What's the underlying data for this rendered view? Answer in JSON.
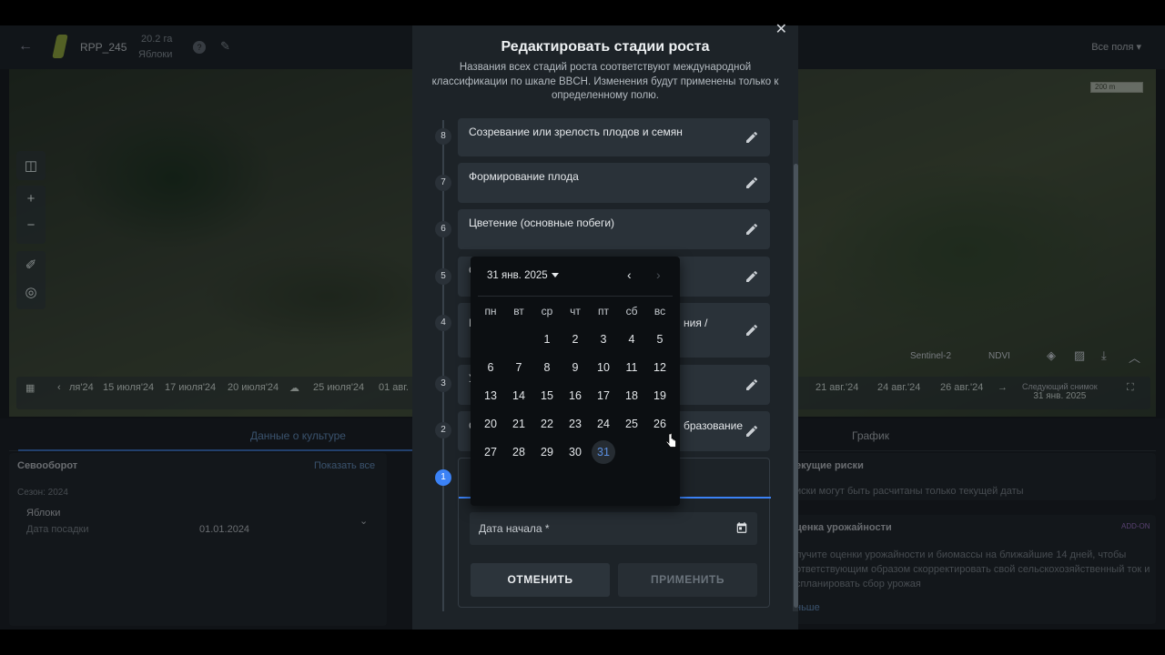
{
  "background": {
    "field_name": "RPP_245",
    "field_area": "20.2 га",
    "field_crop": "Яблоки",
    "help": "?",
    "all_fields": "Все поля",
    "scale": "200 m",
    "sat_source": "Sentinel-2",
    "index": "NDVI",
    "timeline": [
      "ля'24",
      "15 июля'24",
      "17 июля'24",
      "20 июля'24",
      "25 июля'24",
      "01 авг.",
      "21 авг.'24",
      "24 авг.'24",
      "26 авг.'24"
    ],
    "next_label": "Следующий снимок",
    "next_date": "31 янв. 2025",
    "tab_data": "Данные о культуре",
    "tab_chart": "График",
    "rotation_title": "Севооборот",
    "show_all": "Показать все",
    "season": "Сезон: 2024",
    "crop": "Яблоки",
    "planting_label": "Дата посадки",
    "planting_date": "01.01.2024",
    "risks_title": "екущие риски",
    "risks_text": "иски могут быть расчитаны только текущей даты",
    "yield_title": "ценка урожайности",
    "addon": "ADD-ON",
    "yield_text": "лучите оценки урожайности и биомассы на ближайшие 14 дней, чтобы ответствующим образом скорректировать свой сельскохозяйственный ток и спланировать сбор урожая",
    "more": "ньше"
  },
  "modal": {
    "title": "Редактировать стадии роста",
    "description": "Названия всех стадий роста соответствуют международной классификации по шкале BBCH. Изменения будут применены только к определенному полю.",
    "stages": [
      {
        "num": "8",
        "label": "Созревание или зрелость плодов и семян"
      },
      {
        "num": "7",
        "label": "Формирование плода"
      },
      {
        "num": "6",
        "label": "Цветение (основные побеги)"
      },
      {
        "num": "5",
        "label": "С"
      },
      {
        "num": "4",
        "label": "Р",
        "label_right": "ния /"
      },
      {
        "num": "3",
        "label": "У"
      },
      {
        "num": "2",
        "label": "С",
        "label_right": "бразование"
      },
      {
        "num": "1",
        "label": ""
      }
    ],
    "date_field_label": "Дата начала *",
    "cancel": "ОТМЕНИТЬ",
    "apply": "ПРИМЕНИТЬ"
  },
  "calendar": {
    "month_label": "31 янв. 2025",
    "weekdays": [
      "пн",
      "вт",
      "ср",
      "чт",
      "пт",
      "сб",
      "вс"
    ],
    "days": [
      "1",
      "2",
      "3",
      "4",
      "5",
      "6",
      "7",
      "8",
      "9",
      "10",
      "11",
      "12",
      "13",
      "14",
      "15",
      "16",
      "17",
      "18",
      "19",
      "20",
      "21",
      "22",
      "23",
      "24",
      "25",
      "26",
      "27",
      "28",
      "29",
      "30",
      "31"
    ],
    "selected": "31"
  },
  "colors": {
    "accent": "#3b82f6",
    "modal_bg": "#1d2328",
    "popup_bg": "#0c0f12"
  }
}
